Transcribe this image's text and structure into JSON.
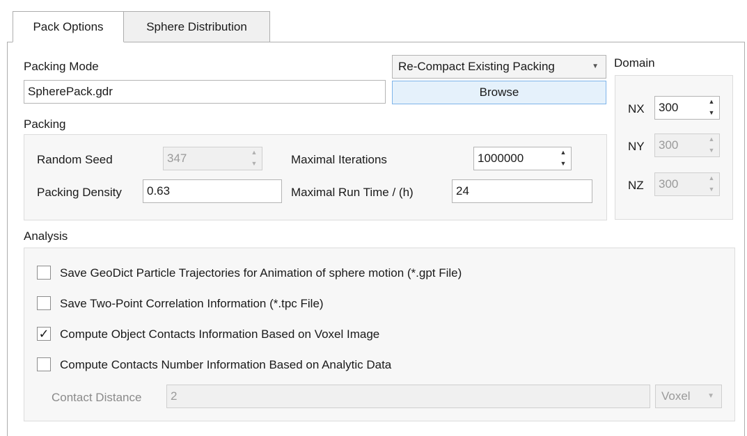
{
  "tabs": [
    {
      "label": "Pack Options"
    },
    {
      "label": "Sphere Distribution"
    }
  ],
  "packing_mode": {
    "label": "Packing Mode",
    "mode_value": "Re-Compact Existing Packing",
    "file_value": "SpherePack.gdr",
    "browse_label": "Browse"
  },
  "domain": {
    "label": "Domain",
    "nx_label": "NX",
    "nx_value": "300",
    "ny_label": "NY",
    "ny_value": "300",
    "nz_label": "NZ",
    "nz_value": "300"
  },
  "packing": {
    "label": "Packing",
    "random_seed_label": "Random Seed",
    "random_seed_value": "347",
    "max_iter_label": "Maximal Iterations",
    "max_iter_value": "1000000",
    "density_label": "Packing Density",
    "density_value": "0.63",
    "run_time_label": "Maximal Run Time / (h)",
    "run_time_value": "24"
  },
  "analysis": {
    "label": "Analysis",
    "options": [
      {
        "label": "Save GeoDict Particle Trajectories for Animation of sphere motion (*.gpt File)",
        "checked": false
      },
      {
        "label": "Save Two-Point Correlation Information (*.tpc File)",
        "checked": false
      },
      {
        "label": "Compute Object Contacts Information Based on Voxel Image",
        "checked": true
      },
      {
        "label": "Compute Contacts Number Information Based on Analytic Data",
        "checked": false
      }
    ],
    "contact_distance_label": "Contact Distance",
    "contact_distance_value": "2",
    "unit_value": "Voxel",
    "check_glyph": "✓"
  }
}
